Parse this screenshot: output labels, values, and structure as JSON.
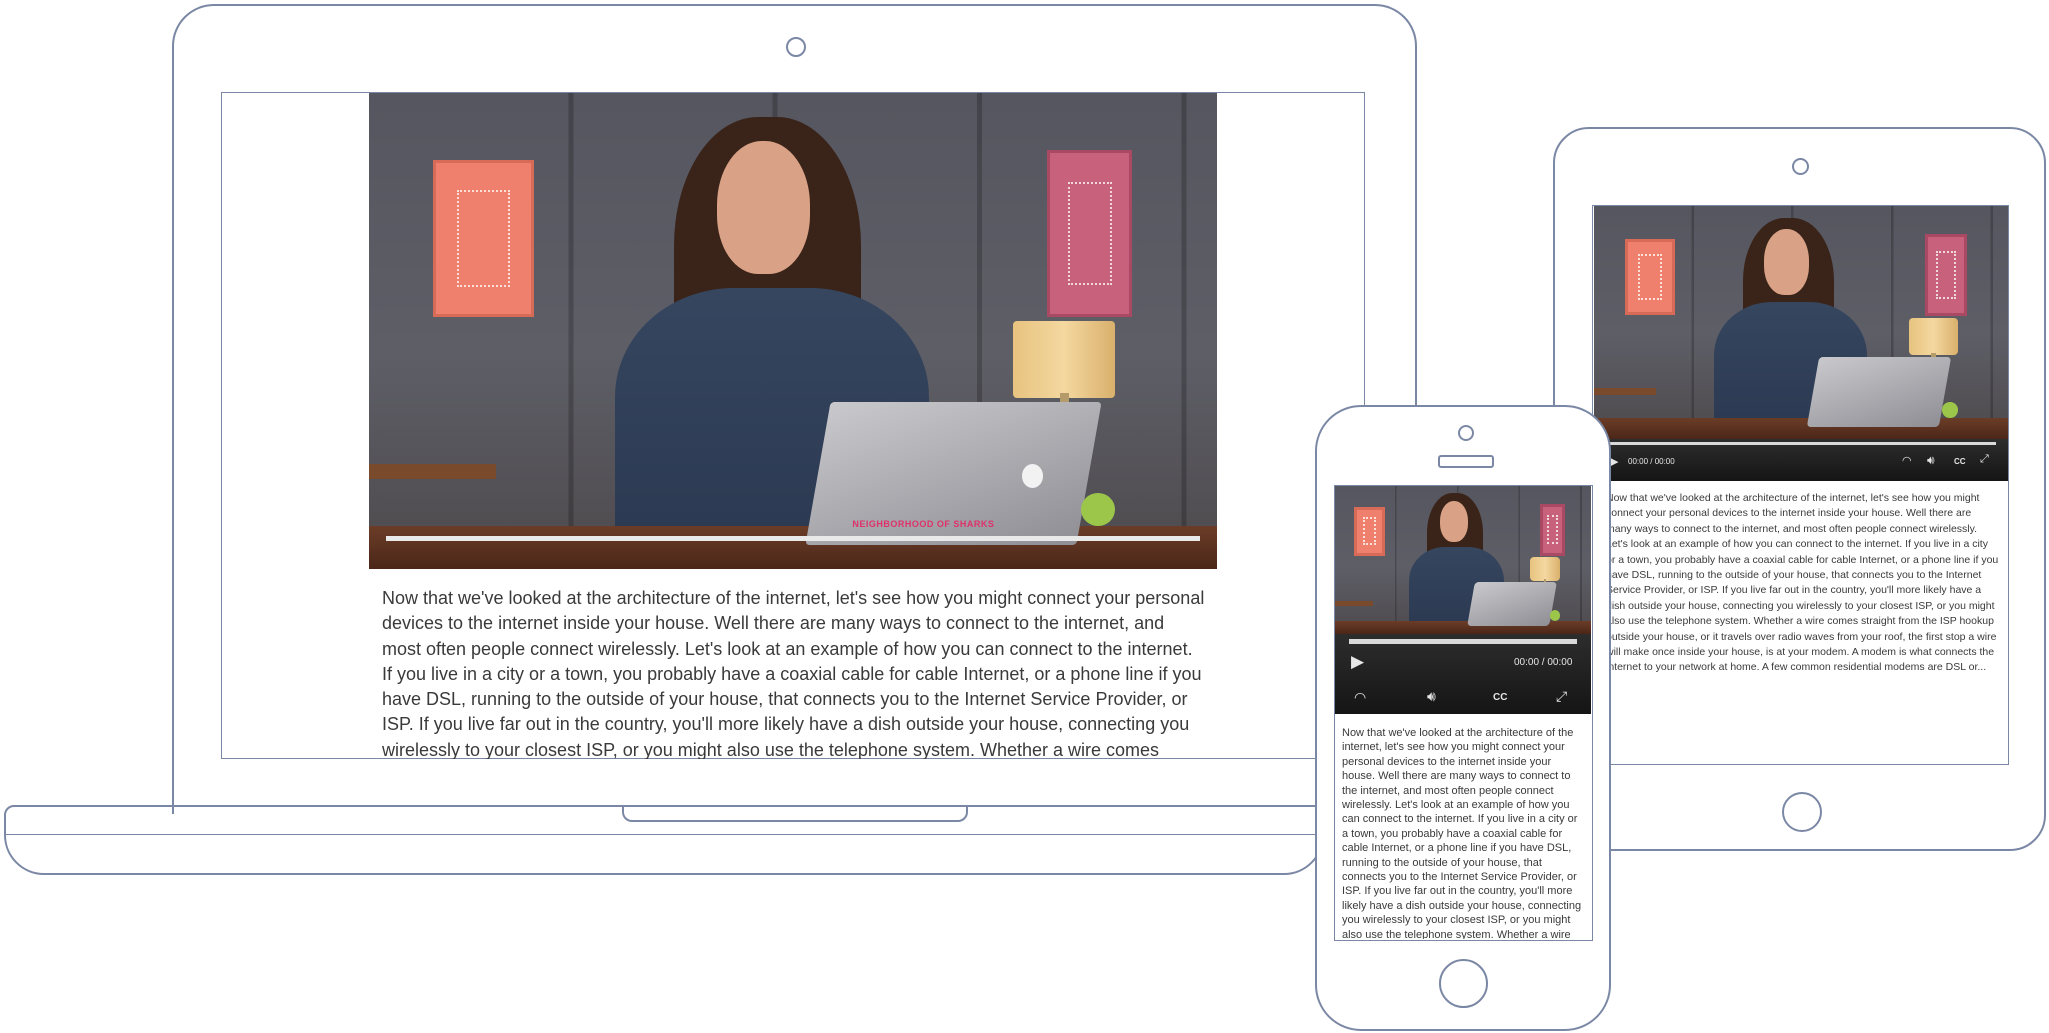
{
  "transcript": "Now that we've looked at the architecture of the internet, let's see how you might connect your personal devices to the internet inside your house. Well there are many ways to connect to the internet, and most often people connect wirelessly. Let's look at an example of how you can connect to the internet. If you live in a city or a town, you probably have a coaxial cable for cable Internet, or a phone line if you have DSL, running to the outside of your house, that connects you to the Internet Service Provider, or ISP. If you live far out in the country, you'll more likely have a dish outside your house, connecting you wirelessly to your closest ISP, or you might also use the telephone system. Whether a wire comes straight from the ISP hookup outside your house, or it travels over radio waves from your roof, the first stop a wire will make once inside your house, is at your modem. A modem is what connects the internet to your network at home. A few common residential modems are DSL or...",
  "video": {
    "time_display": "00:00 / 00:00",
    "cc_label": "CC",
    "watermark": "NEIGHBORHOOD OF SHARKS"
  },
  "icons": {
    "play": "play-icon",
    "speed": "speedometer-icon",
    "volume": "volume-icon",
    "fullscreen": "fullscreen-icon"
  },
  "colors": {
    "device_outline": "#7b88a5",
    "text": "#3a3a3a",
    "controls_bg": "#1f1f1f"
  }
}
